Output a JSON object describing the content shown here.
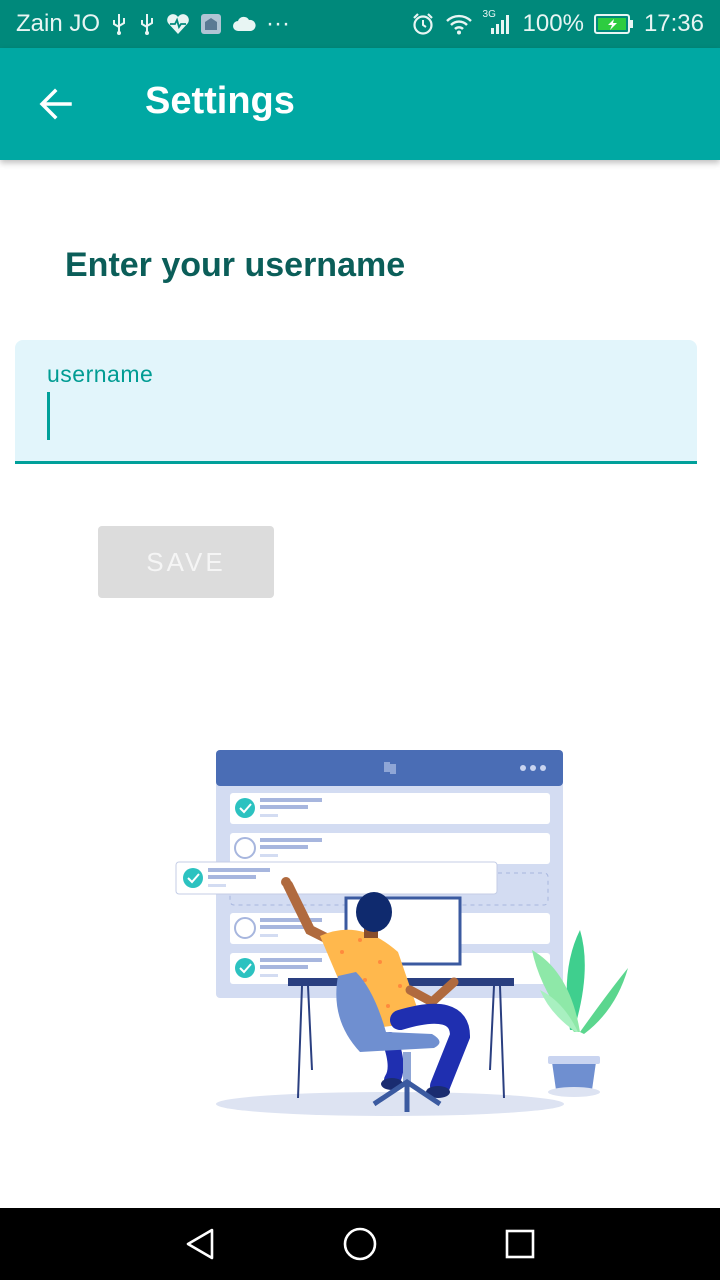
{
  "status_bar": {
    "carrier": "Zain JO",
    "more": "···",
    "network": "3G",
    "battery": "100%",
    "time": "17:36"
  },
  "app_bar": {
    "title": "Settings",
    "back_icon": "arrow-left"
  },
  "main": {
    "heading": "Enter your username",
    "username_field": {
      "label": "username",
      "value": ""
    },
    "save_label": "SAVE"
  },
  "nav_bar": {
    "buttons": [
      "back-triangle",
      "home-circle",
      "recents-square"
    ]
  },
  "colors": {
    "status_bar": "#00897b",
    "app_bar": "#00a8a3",
    "heading": "#0b5e59",
    "accent": "#00a09a",
    "field_bg": "#e2f5fb",
    "button_disabled": "#dcdcdc"
  }
}
